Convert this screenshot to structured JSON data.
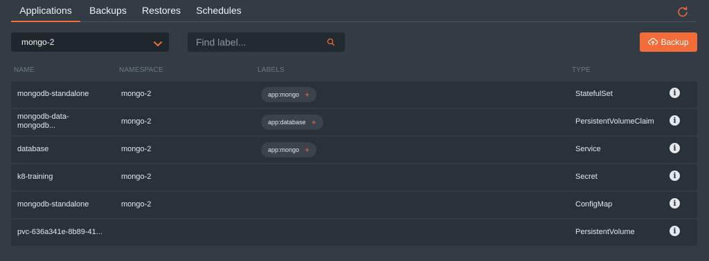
{
  "tabs": [
    "Applications",
    "Backups",
    "Restores",
    "Schedules"
  ],
  "namespace_select": {
    "value": "mongo-2"
  },
  "search": {
    "placeholder": "Find label..."
  },
  "backup_button": {
    "label": "Backup"
  },
  "columns": {
    "name": "NAME",
    "namespace": "NAMESPACE",
    "labels": "LABELS",
    "type": "TYPE"
  },
  "rows": [
    {
      "name": "mongodb-standalone",
      "namespace": "mongo-2",
      "label": "app:mongo",
      "type": "StatefulSet"
    },
    {
      "name": "mongodb-data-mongodb...",
      "namespace": "mongo-2",
      "label": "app:database",
      "type": "PersistentVolumeClaim"
    },
    {
      "name": "database",
      "namespace": "mongo-2",
      "label": "app:mongo",
      "type": "Service"
    },
    {
      "name": "k8-training",
      "namespace": "mongo-2",
      "label": "",
      "type": "Secret"
    },
    {
      "name": "mongodb-standalone",
      "namespace": "mongo-2",
      "label": "",
      "type": "ConfigMap"
    },
    {
      "name": "pvc-636a341e-8b89-41...",
      "namespace": "",
      "label": "",
      "type": "PersistentVolume"
    }
  ],
  "colors": {
    "accent": "#f46c39",
    "background": "#333c44",
    "row": "#2a3239"
  },
  "icons": {
    "refresh": "refresh-icon",
    "chevron": "chevron-down-icon",
    "search": "search-icon",
    "upload": "cloud-upload-icon",
    "info": "info-icon"
  }
}
